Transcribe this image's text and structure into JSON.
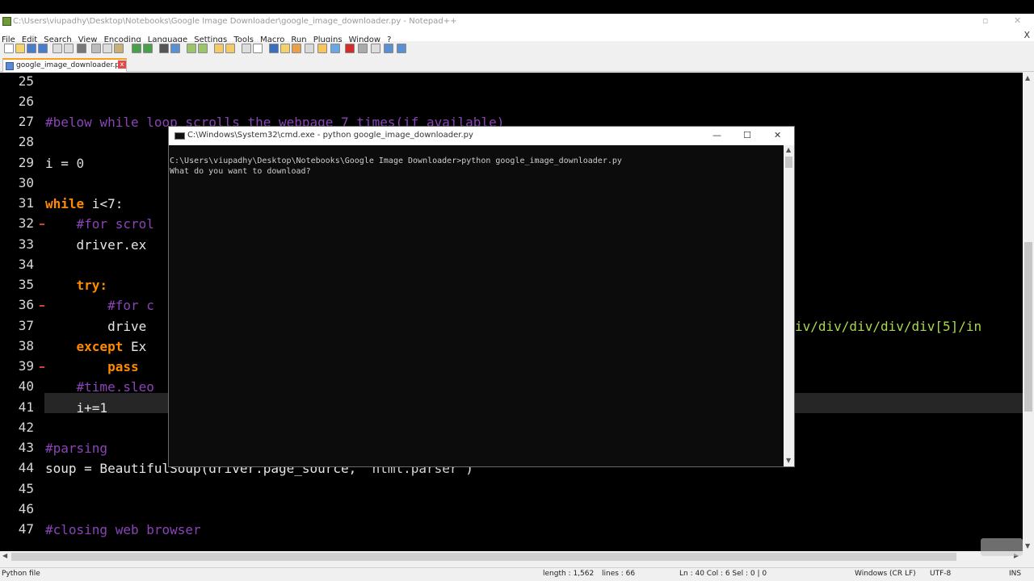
{
  "npp": {
    "title": "C:\\Users\\viupadhy\\Desktop\\Notebooks\\Google Image Downloader\\google_image_downloader.py - Notepad++",
    "menus": [
      "File",
      "Edit",
      "Search",
      "View",
      "Encoding",
      "Language",
      "Settings",
      "Tools",
      "Macro",
      "Run",
      "Plugins",
      "Window",
      "?"
    ],
    "close_glyph": "X",
    "tab": {
      "label": "google_image_downloader.py",
      "close_glyph": "x"
    }
  },
  "editor": {
    "lines": [
      {
        "n": "25"
      },
      {
        "n": "26"
      },
      {
        "n": "27"
      },
      {
        "n": "28"
      },
      {
        "n": "29"
      },
      {
        "n": "30"
      },
      {
        "n": "31"
      },
      {
        "n": "32"
      },
      {
        "n": "33"
      },
      {
        "n": "34"
      },
      {
        "n": "35"
      },
      {
        "n": "36"
      },
      {
        "n": "37"
      },
      {
        "n": "38"
      },
      {
        "n": "39"
      },
      {
        "n": "40"
      },
      {
        "n": "41"
      },
      {
        "n": "42"
      },
      {
        "n": "43"
      },
      {
        "n": "44"
      },
      {
        "n": "45"
      },
      {
        "n": "46"
      },
      {
        "n": "47"
      }
    ],
    "code": {
      "l27": "#below while loop scrolls the webpage 7 times(if available)",
      "l29_a": "i = ",
      "l29_b": "0",
      "l31_kw": "while",
      "l31_rest": " i<7:",
      "l32": "    #for scrol",
      "l33": "    driver.ex",
      "l35_ind": "    ",
      "l35_kw": "try:",
      "l36": "        #for c",
      "l37": "        drive",
      "l37_right": "iv/div/div/div/div[5]/in",
      "l38_ind": "    ",
      "l38_kw": "except",
      "l38_rest": " Ex",
      "l39_ind": "        ",
      "l39_kw": "pass",
      "l40": "    #time.sleo",
      "l41": "    i+=1",
      "l43": "#parsing",
      "l44_a": "soup = BeautifulSoup(driver.page_source, ",
      "l44_b": "'html.parser'",
      "l44_c": ")",
      "l47": "#closing web browser"
    }
  },
  "status": {
    "file_type": "Python file",
    "length": "length : 1,562",
    "lines": "lines : 66",
    "position": "Ln : 40    Col : 6    Sel : 0 | 0",
    "eol": "Windows (CR LF)",
    "encoding": "UTF-8",
    "mode": "INS"
  },
  "cmd": {
    "title": "C:\\Windows\\System32\\cmd.exe - python  google_image_downloader.py",
    "min_glyph": "—",
    "max_glyph": "☐",
    "close_glyph": "✕",
    "output": [
      "C:\\Users\\viupadhy\\Desktop\\Notebooks\\Google Image Downloader>python google_image_downloader.py",
      "What do you want to download?"
    ]
  }
}
